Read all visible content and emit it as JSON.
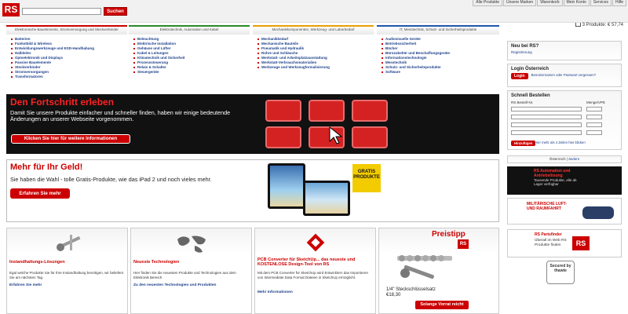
{
  "header": {
    "logo": "RS",
    "search_placeholder": "",
    "search_button": "Suchen",
    "top_links": [
      "Alle Produkte",
      "Unsere Marken",
      "Warenkorb",
      "Mein Konto",
      "Services",
      "Hilfe"
    ],
    "cart": "3  Produkte: € 57,74"
  },
  "categories": [
    {
      "title": "Elektronische Bauelemente, Stromversorgung und Steckverbinder",
      "items": [
        "Batterien",
        "Funkstbild & Wireless",
        "Entwicklungswerkzeuge und ESD-Handhabung",
        "Halbleiter",
        "Optoelektronik und Displays",
        "Passive Bauelemente",
        "Steckverbinder",
        "Stromversorgungen",
        "Transformatoren"
      ]
    },
    {
      "title": "Elektrotechnik, Automation und Kabel",
      "items": [
        "Beleuchtung",
        "Elektrische Installation",
        "Gehäuse und Lüfter",
        "Kabel & Leitungen",
        "Klimatechnik und Sicherheit",
        "Prozesssteuerung",
        "Relais & Schalter",
        "Steuergeräte"
      ]
    },
    {
      "title": "Mechanikkomponenten, Werkzeug- und Laborbedarf",
      "items": [
        "Mechanikbedarf",
        "Mechanische Bauteile",
        "Pneumatik und Hydraulik",
        "Rohre und Schläuche",
        "Werkstatt- und Arbeitsplatzausstattung",
        "Werkstatt-Verbrauchsmaterialien",
        "Werkzeuge und Werkzeugformalisierung"
      ]
    },
    {
      "title": "IT, Messtechnik, Schutz- und Sicherheitsprodukte",
      "items": [
        "Audiovisuelle Geräte",
        "Betriebssicherheit",
        "Bücher",
        "Bürozubehör und Beschaffungsgeräte",
        "Informationstechnologie",
        "Messtechnik",
        "Schutz- und Sicherheitsprodukte",
        "Software"
      ]
    }
  ],
  "banner1": {
    "title": "Den Fortschritt erleben",
    "text": "Damit Sie unsere Produkte einfacher und schneller finden, haben wir einige bedeutende Änderungen an unserer Webseite vorgenommen.",
    "button": "Klicken Sie hier für weitere Informationen"
  },
  "banner2": {
    "title": "Mehr für Ihr Geld!",
    "text": "Sie haben die Wahl - tolle Gratis-Produkte, wie das iPad 2 und noch vieles mehr.",
    "button": "Erfahren Sie mehr",
    "badge": "GRATIS PRODUKTE"
  },
  "boxes": [
    {
      "title": "Instandhaltungs-Lösungen",
      "text": "Egal welche Produkte Sie für Ihre Instandhaltung benötigen, wir beliefern Sie am nächsten Tag.",
      "link": "Erfahren Sie mehr"
    },
    {
      "title": "Neueste Technologien",
      "text": "Hier finden Sie die neuesten Produkte und Technologien aus dem Elektronik Bereich",
      "link": "Zu den neuesten Technologien und Produkten"
    },
    {
      "title": "PCB Converter für SketchUp... das neueste und KOSTENLOSE Design-Tool von RS",
      "text": "Mit dem PCB Converter für SketchUp wird Entwicklern das Importieren von Intermediate Data Format Dateien in SketchUp ermöglicht.",
      "link": "Mehr Informationen"
    },
    {
      "title": "Preistipp",
      "product": "1/4\" Steckschlüsselsatz",
      "price": "€18,30",
      "button": "Solange Vorrat reicht"
    }
  ],
  "sidebar": {
    "new_title": "Neu bei RS?",
    "register": "Registrierung",
    "login_title": "Login Österreich",
    "login_button": "Login",
    "login_links": "Benutzernamen oder Passwort vergessen?",
    "quick_title": "Schnell Bestellen",
    "col_article": "RS Bestell-Nr.",
    "col_qty": "Menge/VPE",
    "add_button": "Hinzufügen",
    "more_rows": "Hier mehr als 4 Zeilen hier klicken",
    "country": "Österreich",
    "change": "ändern",
    "promo1_title": "RS Automation und Antriebslösung",
    "promo1_text": "Tausende Produkte, alle ab Lager verfügbar",
    "promo2_title": "MILITÄRISCHE LUFT- UND RAUMFAHRT",
    "promo3_title": "RS Partsfinder",
    "promo3_text": "Überall im Web RS Produkte finden",
    "secured": "Secured by thawte"
  }
}
